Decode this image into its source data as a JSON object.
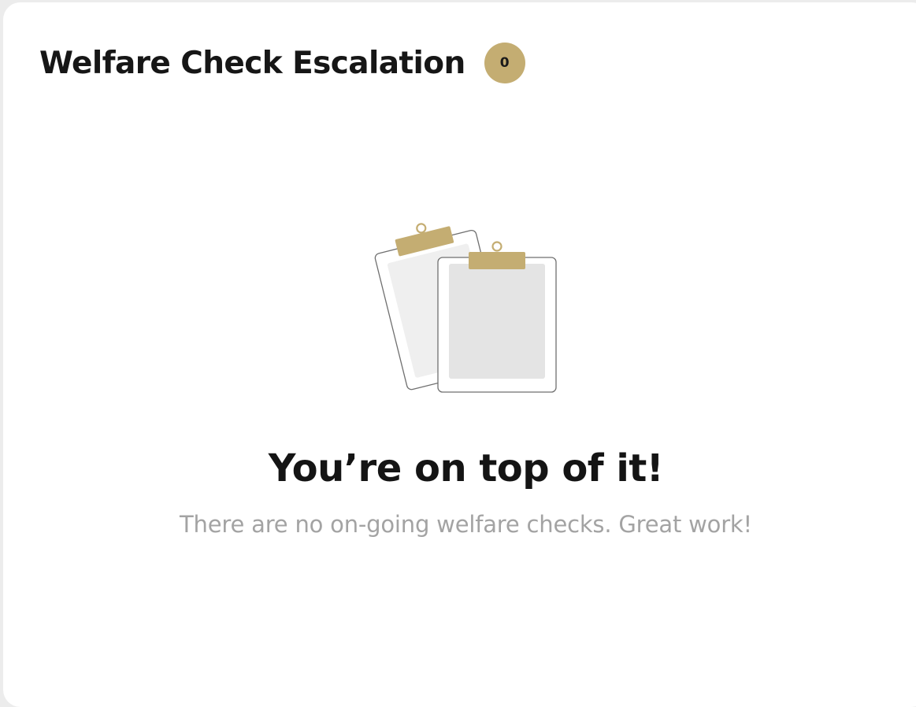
{
  "panel": {
    "title": "Welfare Check Escalation",
    "count": "0"
  },
  "empty_state": {
    "illustration_icon": "clipboards-icon",
    "headline": "You’re on top of it!",
    "message": "There are no on-going welfare checks. Great work!"
  },
  "colors": {
    "accent": "#c4ad72",
    "title_text": "#161616",
    "muted_text": "#a3a3a3",
    "card_background": "#ffffff"
  }
}
